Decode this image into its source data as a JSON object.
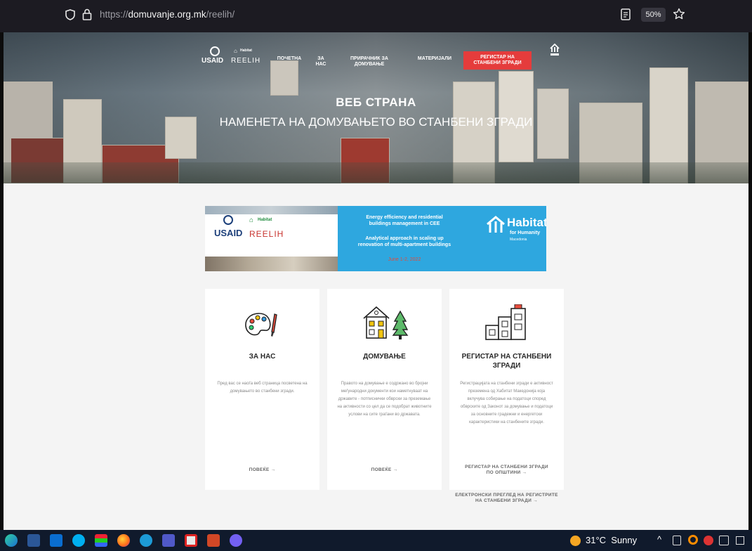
{
  "browser": {
    "url_prefix": "https://",
    "url_domain": "domuvanje.org.mk",
    "url_path": "/reelih/",
    "zoom": "50%"
  },
  "nav": {
    "logo_usaid": "USAID",
    "logo_reelih": "REELIH",
    "habitat_small": "Habitat",
    "items": [
      {
        "label_l1": "ПОЧЕТНА",
        "label_l2": ""
      },
      {
        "label_l1": "ЗА",
        "label_l2": "НАС"
      },
      {
        "label_l1": "ПРИРАЧНИК ЗА",
        "label_l2": "ДОМУВАЊЕ"
      },
      {
        "label_l1": "МАТЕРИЈАЛИ",
        "label_l2": ""
      }
    ],
    "cta_l1": "РЕГИСТАР НА",
    "cta_l2": "СТАНБЕНИ ЗГРАДИ"
  },
  "hero": {
    "title": "ВЕБ СТРАНА",
    "subtitle": "НАМЕНЕТА НА ДОМУВАЊЕТО ВО СТАНБЕНИ ЗГРАДИ"
  },
  "banner": {
    "usaid": "USAID",
    "reelih": "REELIH",
    "habitat_small": "Habitat",
    "line1": "Energy efficiency and residential",
    "line2": "buildings management in CEE",
    "line3": "Analytical approach in scaling up",
    "line4": "renovation of multi-apartment buildings",
    "date": "June 1-2, 2022",
    "habitat": "Habitat",
    "humanity": "for Humanity",
    "country": "Macedonia"
  },
  "cards": [
    {
      "title_l1": "ЗА НАС",
      "title_l2": "",
      "text": "Пред вас се наоѓа веб страница посветена на домувањето во станбени згради.",
      "link1_l1": "ПОВЕЌЕ →",
      "link1_l2": ""
    },
    {
      "title_l1": "ДОМУВАЊЕ",
      "title_l2": "",
      "text": "Правото на домување е содржано во бројни меѓународни документи кои наметнуваат на државите - потписнички обврски за преземање на активности со цел да се подобрат животните услови на сите граѓани во државата.",
      "link1_l1": "ПОВЕЌЕ →",
      "link1_l2": ""
    },
    {
      "title_l1": "РЕГИСТАР НА СТАНБЕНИ",
      "title_l2": "ЗГРАДИ",
      "text": "Регистрацијата на станбени згради е активност преземена од Хабитат Македонија која вклучува собирање на податоци според обврските од Законот за домување и податоци за основните градежни и енергетски карактеристики на станбените згради.",
      "link1_l1": "РЕГИСТАР НА СТАНБЕНИ ЗГРАДИ",
      "link1_l2": "ПО ОПШТИНИ →",
      "link2_l1": "ЕЛЕКТРОНСКИ ПРЕГЛЕД НА РЕГИСТРИТЕ",
      "link2_l2": "НА СТАНБЕНИ ЗГРАДИ →"
    }
  ],
  "taskbar": {
    "weather": "31°C  Sunny"
  }
}
